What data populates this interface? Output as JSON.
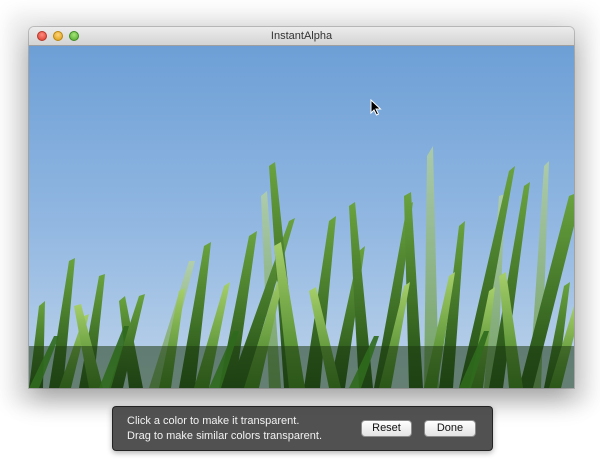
{
  "window": {
    "title": "InstantAlpha"
  },
  "hud": {
    "line1": "Click a color to make it transparent.",
    "line2": "Drag to make similar colors transparent.",
    "reset_label": "Reset",
    "done_label": "Done"
  },
  "photo": {
    "subject": "green grass blades against blue sky",
    "sky_top_color": "#6d9fd6",
    "sky_bottom_color": "#b9d1ea",
    "grass_color": "#3f7a27"
  }
}
